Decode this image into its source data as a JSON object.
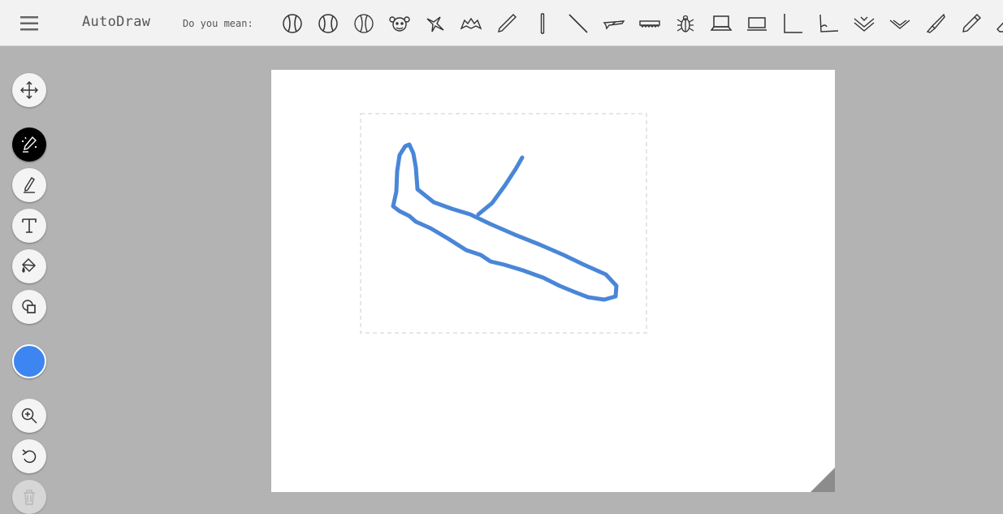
{
  "app": {
    "title": "AutoDraw"
  },
  "header": {
    "menu_icon": "hamburger-menu-icon",
    "suggestion_label": "Do you mean:",
    "suggestions": [
      {
        "icon": "baseball-icon"
      },
      {
        "icon": "baseball-icon"
      },
      {
        "icon": "baseball-icon"
      },
      {
        "icon": "monkey-face-icon"
      },
      {
        "icon": "hummingbird-icon"
      },
      {
        "icon": "bat-icon"
      },
      {
        "icon": "pencil-icon"
      },
      {
        "icon": "stick-icon"
      },
      {
        "icon": "line-icon"
      },
      {
        "icon": "airplane-icon"
      },
      {
        "icon": "saw-icon"
      },
      {
        "icon": "beetle-icon"
      },
      {
        "icon": "laptop-icon"
      },
      {
        "icon": "laptop-icon"
      },
      {
        "icon": "ruler-corner-icon"
      },
      {
        "icon": "ruler-corner-icon"
      },
      {
        "icon": "chevron-shape-icon"
      },
      {
        "icon": "chevron-shape-icon"
      },
      {
        "icon": "knife-icon"
      },
      {
        "icon": "pen-icon"
      },
      {
        "icon": "eraser-icon"
      }
    ]
  },
  "toolbar": {
    "tools": [
      {
        "icon": "move-icon",
        "active": false
      },
      {
        "icon": "autodraw-magic-icon",
        "active": true
      },
      {
        "icon": "draw-icon",
        "active": false
      },
      {
        "icon": "type-icon",
        "active": false
      },
      {
        "icon": "fill-icon",
        "active": false
      },
      {
        "icon": "shape-icon",
        "active": false
      },
      {
        "icon": "color-picker-icon",
        "color": "#3d85f0"
      },
      {
        "icon": "zoom-in-icon",
        "active": false
      },
      {
        "icon": "undo-icon",
        "active": false
      },
      {
        "icon": "delete-icon",
        "disabled": true
      }
    ]
  },
  "canvas": {
    "background": "#ffffff",
    "stroke_color": "#4a86d8",
    "selection_border_color": "#dddddd"
  }
}
